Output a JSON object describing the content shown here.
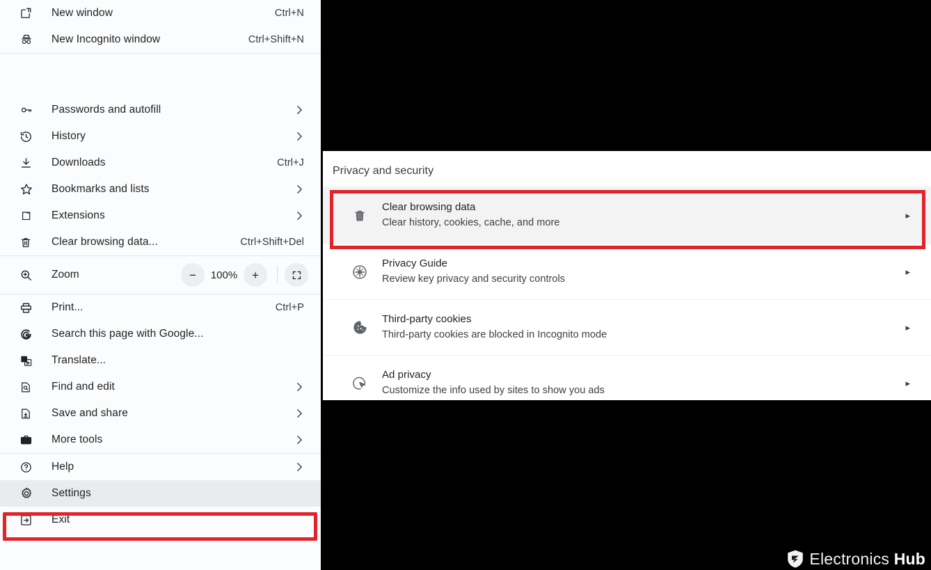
{
  "chrome_menu": {
    "top_items": [
      {
        "icon": "new-window-icon",
        "label": "New window",
        "accel": "Ctrl+N",
        "submenu": false
      },
      {
        "icon": "incognito-icon",
        "label": "New Incognito window",
        "accel": "Ctrl+Shift+N",
        "submenu": false
      }
    ],
    "main_items": [
      {
        "icon": "key-icon",
        "label": "Passwords and autofill",
        "accel": "",
        "submenu": true
      },
      {
        "icon": "history-icon",
        "label": "History",
        "accel": "",
        "submenu": true
      },
      {
        "icon": "download-icon",
        "label": "Downloads",
        "accel": "Ctrl+J",
        "submenu": false
      },
      {
        "icon": "star-icon",
        "label": "Bookmarks and lists",
        "accel": "",
        "submenu": true
      },
      {
        "icon": "puzzle-icon",
        "label": "Extensions",
        "accel": "",
        "submenu": true
      },
      {
        "icon": "trash-icon",
        "label": "Clear browsing data...",
        "accel": "Ctrl+Shift+Del",
        "submenu": false
      }
    ],
    "zoom": {
      "icon": "zoom-in-icon",
      "label": "Zoom",
      "minus_label": "−",
      "value": "100%",
      "plus_label": "+",
      "fullscreen_icon": "fullscreen-icon"
    },
    "tools_items": [
      {
        "icon": "printer-icon",
        "label": "Print...",
        "accel": "Ctrl+P",
        "submenu": false
      },
      {
        "icon": "google-g-icon",
        "label": "Search this page with Google...",
        "accel": "",
        "submenu": false
      },
      {
        "icon": "translate-icon",
        "label": "Translate...",
        "accel": "",
        "submenu": false
      },
      {
        "icon": "find-edit-icon",
        "label": "Find and edit",
        "accel": "",
        "submenu": true
      },
      {
        "icon": "save-share-icon",
        "label": "Save and share",
        "accel": "",
        "submenu": true
      },
      {
        "icon": "toolbox-icon",
        "label": "More tools",
        "accel": "",
        "submenu": true
      }
    ],
    "bottom_items": [
      {
        "icon": "help-icon",
        "label": "Help",
        "accel": "",
        "submenu": true,
        "highlighted": false
      },
      {
        "icon": "gear-icon",
        "label": "Settings",
        "accel": "",
        "submenu": false,
        "highlighted": true
      },
      {
        "icon": "exit-icon",
        "label": "Exit",
        "accel": "",
        "submenu": false,
        "highlighted": false
      }
    ]
  },
  "settings_panel": {
    "title": "Privacy and security",
    "rows": [
      {
        "icon": "trash-icon",
        "heading": "Clear browsing data",
        "subtitle": "Clear history, cookies, cache, and more",
        "arrow": "▸",
        "highlighted": true
      },
      {
        "icon": "compass-icon",
        "heading": "Privacy Guide",
        "subtitle": "Review key privacy and security controls",
        "arrow": "▸",
        "highlighted": false
      },
      {
        "icon": "cookie-icon",
        "heading": "Third-party cookies",
        "subtitle": "Third-party cookies are blocked in Incognito mode",
        "arrow": "▸",
        "highlighted": false
      },
      {
        "icon": "ad-privacy-icon",
        "heading": "Ad privacy",
        "subtitle": "Customize the info used by sites to show you ads",
        "arrow": "▸",
        "highlighted": false
      }
    ]
  },
  "watermark": {
    "logo_icon": "shield-logo-icon",
    "text_light": "Electronics ",
    "text_bold": "Hub"
  },
  "colors": {
    "highlight_red": "#e32229",
    "menu_bg": "#fbfcfd",
    "panel_bg": "#ffffff",
    "row_selected_bg": "#f3f3f3",
    "page_bg": "#000000"
  }
}
